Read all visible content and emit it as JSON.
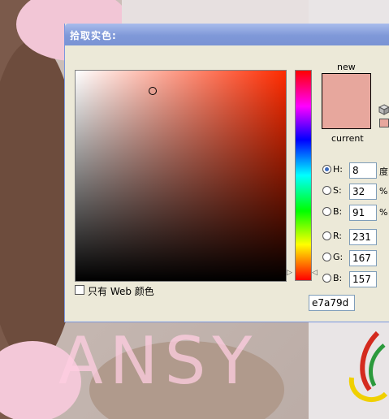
{
  "dialog": {
    "title": "拾取实色:",
    "new_label": "new",
    "current_label": "current",
    "web_only_label": "只有 Web 颜色",
    "hex_label": "#",
    "hex_value": "e7a79d"
  },
  "colors": {
    "new": "#e7a79d",
    "current": "#e7a79d",
    "hue_base": "#ff2b00"
  },
  "hsb": [
    {
      "label": "H:",
      "value": "8",
      "unit": "度",
      "selected": true
    },
    {
      "label": "S:",
      "value": "32",
      "unit": "%",
      "selected": false
    },
    {
      "label": "B:",
      "value": "91",
      "unit": "%",
      "selected": false
    }
  ],
  "rgb": [
    {
      "label": "R:",
      "value": "231"
    },
    {
      "label": "G:",
      "value": "167"
    },
    {
      "label": "B:",
      "value": "157"
    }
  ],
  "watermark": "ANSY"
}
